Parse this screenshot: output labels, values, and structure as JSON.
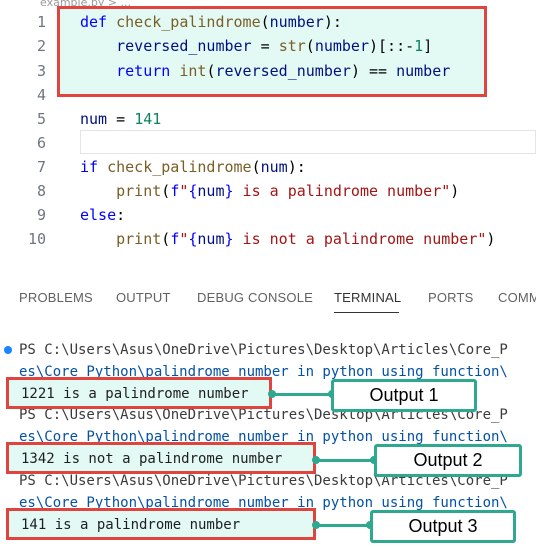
{
  "editor": {
    "breadcrumb": "example.py > ...",
    "lines": [
      {
        "n": "1",
        "parts": [
          [
            "kw",
            "def "
          ],
          [
            "fn",
            "check_palindrome"
          ],
          [
            "",
            "("
          ],
          [
            "var",
            "number"
          ],
          [
            "",
            "):"
          ]
        ]
      },
      {
        "n": "2",
        "parts": [
          [
            "",
            "    "
          ],
          [
            "var",
            "reversed_number"
          ],
          [
            "",
            " = "
          ],
          [
            "fn",
            "str"
          ],
          [
            "",
            "("
          ],
          [
            "var",
            "number"
          ],
          [
            "",
            ")[::-"
          ],
          [
            "num",
            "1"
          ],
          [
            "",
            "]"
          ]
        ]
      },
      {
        "n": "3",
        "parts": [
          [
            "",
            "    "
          ],
          [
            "kw",
            "return "
          ],
          [
            "fn",
            "int"
          ],
          [
            "",
            "("
          ],
          [
            "var",
            "reversed_number"
          ],
          [
            "",
            ") == "
          ],
          [
            "var",
            "number"
          ]
        ]
      },
      {
        "n": "4",
        "parts": []
      },
      {
        "n": "5",
        "parts": [
          [
            "var",
            "num"
          ],
          [
            "",
            " = "
          ],
          [
            "num",
            "141"
          ]
        ]
      },
      {
        "n": "6",
        "parts": []
      },
      {
        "n": "7",
        "parts": [
          [
            "kw",
            "if "
          ],
          [
            "fn",
            "check_palindrome"
          ],
          [
            "",
            "("
          ],
          [
            "var",
            "num"
          ],
          [
            "",
            "):"
          ]
        ]
      },
      {
        "n": "8",
        "parts": [
          [
            "",
            "    "
          ],
          [
            "fn",
            "print"
          ],
          [
            "",
            "("
          ],
          [
            "kw",
            "f"
          ],
          [
            "str",
            "\""
          ],
          [
            "kw",
            "{"
          ],
          [
            "var",
            "num"
          ],
          [
            "kw",
            "}"
          ],
          [
            "str",
            " is a palindrome number\""
          ],
          [
            "",
            ")"
          ]
        ]
      },
      {
        "n": "9",
        "parts": [
          [
            "kw",
            "else"
          ],
          [
            "",
            ":"
          ]
        ]
      },
      {
        "n": "10",
        "parts": [
          [
            "",
            "    "
          ],
          [
            "fn",
            "print"
          ],
          [
            "",
            "("
          ],
          [
            "kw",
            "f"
          ],
          [
            "str",
            "\""
          ],
          [
            "kw",
            "{"
          ],
          [
            "var",
            "num"
          ],
          [
            "kw",
            "}"
          ],
          [
            "str",
            " is not a palindrome number\""
          ],
          [
            "",
            ")"
          ]
        ]
      }
    ]
  },
  "panel": {
    "tabs": [
      "PROBLEMS",
      "OUTPUT",
      "DEBUG CONSOLE",
      "TERMINAL",
      "PORTS",
      "COMM"
    ],
    "active_tab": "TERMINAL"
  },
  "terminal": {
    "prompt1": "PS C:\\Users\\Asus\\OneDrive\\Pictures\\Desktop\\Articles\\Core_P",
    "prompt1_cont": "es\\Core_Python\\palindrome number in python using function\\",
    "output1": "1221 is a palindrome number",
    "prompt2": "PS C:\\Users\\Asus\\OneDrive\\Pictures\\Desktop\\Articles\\Core_P",
    "prompt2_cont": "es\\Core_Python\\palindrome number in python using function\\",
    "output2": "1342 is not a palindrome number",
    "prompt3": "PS C:\\Users\\Asus\\OneDrive\\Pictures\\Desktop\\Articles\\Core_P",
    "prompt3_cont": "es\\Core_Python\\palindrome number in python using function\\",
    "output3": "141 is a palindrome number"
  },
  "callouts": {
    "c1": "Output 1",
    "c2": "Output 2",
    "c3": "Output 3"
  },
  "colors": {
    "highlight_border": "#e0443e",
    "highlight_fill": "#e3f9f4",
    "callout_border": "#2ea88f"
  }
}
